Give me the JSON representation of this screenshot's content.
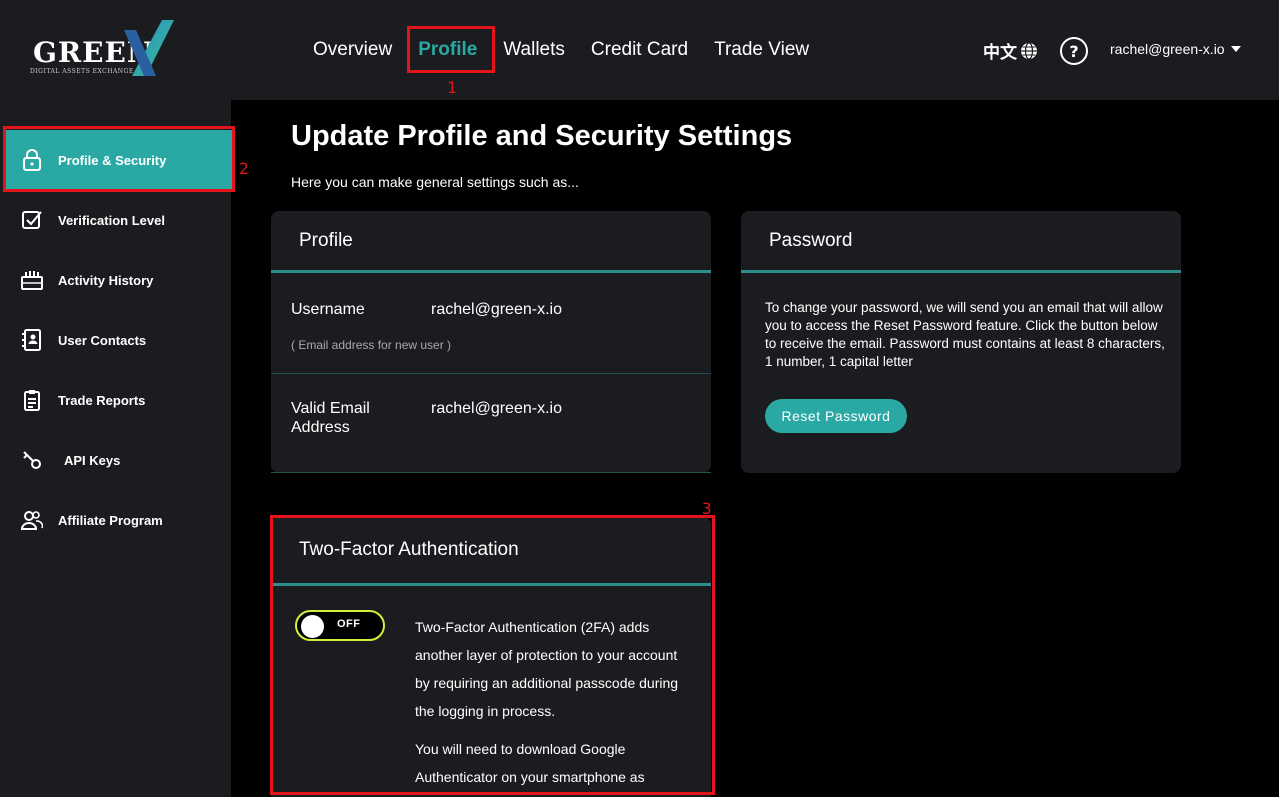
{
  "brand": {
    "logo_text": "GREEN",
    "logo_sub": "DIGITAL ASSETS EXCHANGE",
    "accent": "#2aa9a4"
  },
  "nav": {
    "items": [
      {
        "label": "Overview",
        "active": false
      },
      {
        "label": "Profile",
        "active": true
      },
      {
        "label": "Wallets",
        "active": false
      },
      {
        "label": "Credit Card",
        "active": false
      },
      {
        "label": "Trade View",
        "active": false
      }
    ],
    "language": "中文",
    "user": "rachel@green-x.io"
  },
  "sidebar": {
    "items": [
      {
        "label": "Profile & Security",
        "icon": "lock-icon",
        "active": true
      },
      {
        "label": "Verification Level",
        "icon": "checkbox-icon",
        "active": false
      },
      {
        "label": "Activity History",
        "icon": "history-icon",
        "active": false
      },
      {
        "label": "User Contacts",
        "icon": "contacts-icon",
        "active": false
      },
      {
        "label": "Trade Reports",
        "icon": "report-icon",
        "active": false
      },
      {
        "label": "API Keys",
        "icon": "key-icon",
        "active": false
      },
      {
        "label": "Affiliate Program",
        "icon": "users-icon",
        "active": false
      }
    ]
  },
  "main": {
    "title": "Update Profile and Security Settings",
    "subtitle": "Here you can make general settings such as..."
  },
  "profile_card": {
    "title": "Profile",
    "username_label": "Username",
    "username_value": "rachel@green-x.io",
    "username_hint": "( Email address for new user )",
    "email_label_line1": "Valid Email",
    "email_label_line2": "Address",
    "email_value": "rachel@green-x.io"
  },
  "password_card": {
    "title": "Password",
    "text": "To change your password, we will send you an email that will allow you to access the Reset Password feature. Click the button below to receive the email. Password must contains at least 8 characters, 1 number, 1 capital letter",
    "button": "Reset Password"
  },
  "tfa_card": {
    "title": "Two-Factor Authentication",
    "toggle_state": "OFF",
    "para1": "Two-Factor Authentication (2FA) adds another layer of protection to your account by requiring an additional passcode during the logging in process.",
    "para2": "You will need to download Google Authenticator on your smartphone as"
  },
  "annotations": {
    "color": "#e3141b",
    "labels": [
      "1",
      "2",
      "3"
    ]
  }
}
